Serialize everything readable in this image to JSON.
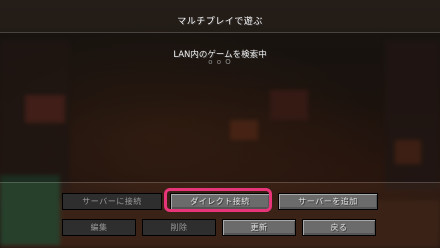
{
  "screen": {
    "title": "マルチプレイで遊ぶ",
    "lan_scan": {
      "label": "LAN内のゲームを検索中",
      "indicator": "o o O"
    }
  },
  "buttons": {
    "row1": {
      "join_server": {
        "label": "サーバーに接続",
        "enabled": false
      },
      "direct_connect": {
        "label": "ダイレクト接続",
        "enabled": true
      },
      "add_server": {
        "label": "サーバーを追加",
        "enabled": true
      }
    },
    "row2": {
      "edit": {
        "label": "編集",
        "enabled": false
      },
      "delete": {
        "label": "削除",
        "enabled": false
      },
      "refresh": {
        "label": "更新",
        "enabled": true
      },
      "back": {
        "label": "戻る",
        "enabled": true
      }
    }
  },
  "colors": {
    "highlight": "#e8357a",
    "button": "#6b6b6b",
    "button_disabled": "#2e2e2e"
  }
}
